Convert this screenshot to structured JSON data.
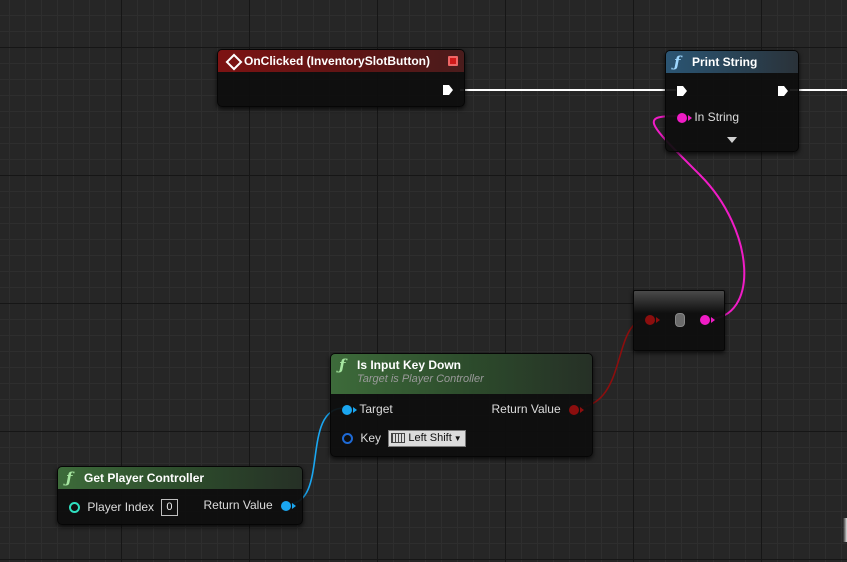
{
  "graph": {
    "nodes": {
      "on_clicked": {
        "title": "OnClicked (InventorySlotButton)"
      },
      "print_string": {
        "title": "Print String",
        "icon": "function-icon",
        "inputs": {
          "in_string_label": "In String"
        }
      },
      "is_input_key_down": {
        "title": "Is Input Key Down",
        "subtitle": "Target is Player Controller",
        "icon": "function-icon",
        "inputs": {
          "target_label": "Target",
          "key_label": "Key",
          "key_value": "Left Shift"
        },
        "outputs": {
          "return_label": "Return Value"
        }
      },
      "get_player_controller": {
        "title": "Get Player Controller",
        "icon": "function-icon",
        "inputs": {
          "player_index_label": "Player Index",
          "player_index_value": "0"
        },
        "outputs": {
          "return_label": "Return Value"
        }
      }
    },
    "icons": {
      "function": "ƒ"
    },
    "colors": {
      "exec_wire": "#ffffff",
      "string_wire": "#f01cc6",
      "bool_wire": "#8c0e0e",
      "object_wire": "#1aa6f0",
      "event_header": "#7d1313",
      "call_header": "#2b5573",
      "pure_header": "#3d6b3a"
    }
  }
}
